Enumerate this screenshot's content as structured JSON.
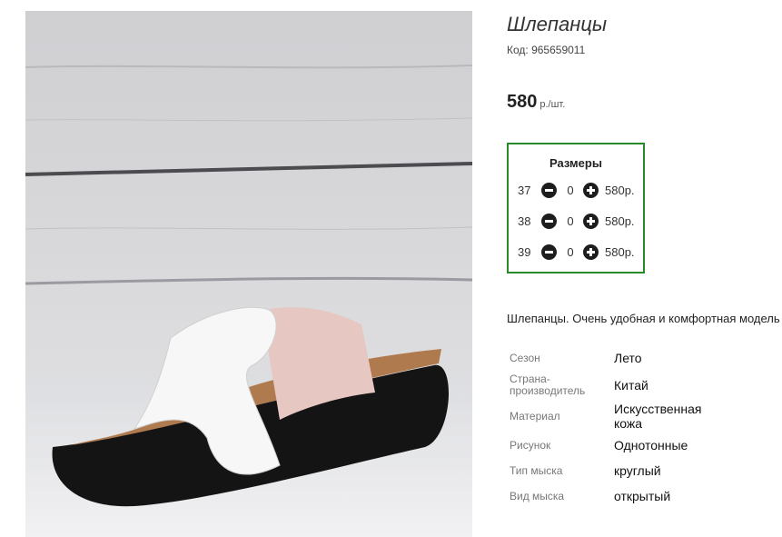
{
  "product": {
    "title": "Шлепанцы",
    "code": "Код: 965659011",
    "price": "580",
    "price_unit": "р./шт."
  },
  "sizes": {
    "title": "Размеры",
    "rows": [
      {
        "size": "37",
        "qty": "0",
        "price": "580р."
      },
      {
        "size": "38",
        "qty": "0",
        "price": "580р."
      },
      {
        "size": "39",
        "qty": "0",
        "price": "580р."
      }
    ]
  },
  "description": "Шлепанцы. Очень удобная и комфортная модель",
  "attributes": [
    {
      "key": "Сезон",
      "value": "Лето"
    },
    {
      "key": "Страна-производитель",
      "value": "Китай"
    },
    {
      "key": "Материал",
      "value": "Искусственная кожа"
    },
    {
      "key": "Рисунок",
      "value": "Однотонные"
    },
    {
      "key": "Тип мыска",
      "value": "круглый"
    },
    {
      "key": "Вид мыска",
      "value": "открытый"
    }
  ],
  "colors": {
    "accent_border": "#2a8a2a"
  },
  "icons": {
    "minus": "minus-circle-icon",
    "plus": "plus-circle-icon"
  }
}
